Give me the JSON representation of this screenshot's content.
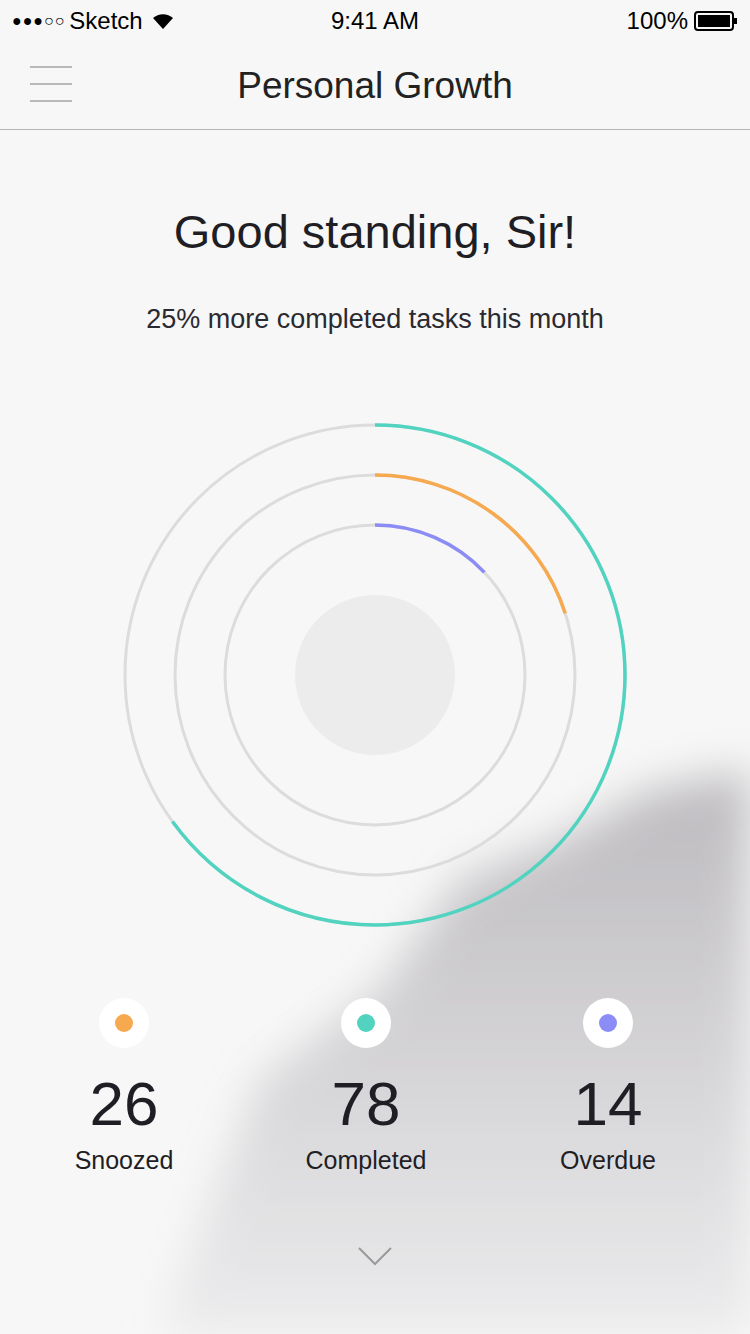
{
  "status_bar": {
    "signal": "●●●○○",
    "carrier": "Sketch",
    "time": "9:41 AM",
    "battery": "100%"
  },
  "nav": {
    "title": "Personal Growth"
  },
  "heading": "Good standing, Sir!",
  "subtitle": "25% more completed tasks this month",
  "rings": [
    {
      "name": "Completed",
      "level": 0.65,
      "color": "#52d3c0"
    },
    {
      "name": "Snoozed",
      "level": 0.2,
      "color": "#f6a94e"
    },
    {
      "name": "Overdue",
      "level": 0.13,
      "color": "#8b8cf6"
    }
  ],
  "stats": [
    {
      "value": "26",
      "label": "Snoozed",
      "color": "#f6a94e"
    },
    {
      "value": "78",
      "label": "Completed",
      "color": "#52d3c0"
    },
    {
      "value": "14",
      "label": "Overdue",
      "color": "#8b8cf6"
    }
  ]
}
